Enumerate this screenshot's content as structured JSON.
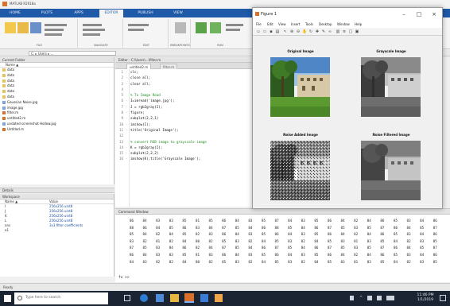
{
  "matlab": {
    "title": "MATLAB R2018a",
    "ribbon_tabs": [
      "HOME",
      "PLOTS",
      "APPS",
      "EDITOR",
      "PUBLISH",
      "VIEW"
    ],
    "active_tab": "EDITOR",
    "ribbon_groups": [
      "FILE",
      "NAVIGATE",
      "EDIT",
      "BREAKPOINTS",
      "RUN"
    ],
    "address_path": "C: ▸ Users ▸ ...",
    "current_folder": {
      "title": "Current Folder",
      "column": "Name ▲",
      "files": [
        "data",
        "data",
        "data",
        "data",
        "data",
        "data",
        "Gaussian Noise.jpg",
        "image.jpg",
        "filter.m",
        "untitled2.m",
        "undated screenshot Hollow.jpg",
        "Untitled.m"
      ],
      "details": "Details"
    },
    "workspace": {
      "title": "Workspace",
      "col_name": "Name ▲",
      "col_value": "Value",
      "rows": [
        {
          "name": "I",
          "value": "256x256 uint8"
        },
        {
          "name": "J",
          "value": "256x256 uint8"
        },
        {
          "name": "K",
          "value": "256x256 uint8"
        },
        {
          "name": "L",
          "value": "256x256 uint8"
        },
        {
          "name": "ans",
          "value": "3x3 filter coefficients"
        },
        {
          "name": "a1",
          "value": ""
        }
      ]
    },
    "editor": {
      "title": "Editor - C:\\Users\\...\\filter.m",
      "tabs": [
        "untitled2.m",
        "filter.m"
      ],
      "lines": [
        {
          "n": "1",
          "dash": "-",
          "code": "clc;",
          "kind": "code"
        },
        {
          "n": "2",
          "dash": "-",
          "code": "close all;",
          "kind": "code"
        },
        {
          "n": "3",
          "dash": "-",
          "code": "clear all;",
          "kind": "code"
        },
        {
          "n": "4",
          "dash": "",
          "code": "",
          "kind": "code"
        },
        {
          "n": "5",
          "dash": "",
          "code": "% To Image Read",
          "kind": "comment"
        },
        {
          "n": "6",
          "dash": "-",
          "code": "I=imread('image.jpg');",
          "kind": "code"
        },
        {
          "n": "7",
          "dash": "-",
          "code": "J = rgb2gray(I);",
          "kind": "code"
        },
        {
          "n": "8",
          "dash": "-",
          "code": "figure;",
          "kind": "code"
        },
        {
          "n": "9",
          "dash": "-",
          "code": "subplot(2,2,1)",
          "kind": "code"
        },
        {
          "n": "10",
          "dash": "-",
          "code": "imshow(I);",
          "kind": "code"
        },
        {
          "n": "11",
          "dash": "-",
          "code": "title('Original Image');",
          "kind": "code"
        },
        {
          "n": "12",
          "dash": "",
          "code": "",
          "kind": "code"
        },
        {
          "n": "13",
          "dash": "",
          "code": "% convert RGB image to grayscale image",
          "kind": "comment"
        },
        {
          "n": "14",
          "dash": "-",
          "code": "K = rgb2gray(I);",
          "kind": "code"
        },
        {
          "n": "15",
          "dash": "-",
          "code": "subplot(2,2,2)",
          "kind": "code"
        },
        {
          "n": "16",
          "dash": "-",
          "code": "imshow(K);title('Grayscale Image');",
          "kind": "code"
        }
      ]
    },
    "command_window": {
      "title": "Command Window",
      "rows": [
        [
          "86",
          "84",
          "83",
          "83",
          "85",
          "81",
          "85",
          "86",
          "84",
          "83",
          "85",
          "87",
          "84",
          "83",
          "85",
          "86",
          "84",
          "82",
          "84",
          "86",
          "85",
          "83",
          "84",
          "86"
        ],
        [
          "88",
          "86",
          "84",
          "85",
          "86",
          "83",
          "84",
          "87",
          "85",
          "84",
          "86",
          "88",
          "85",
          "84",
          "86",
          "87",
          "85",
          "83",
          "85",
          "87",
          "86",
          "84",
          "85",
          "87"
        ],
        [
          "85",
          "84",
          "82",
          "84",
          "85",
          "82",
          "83",
          "86",
          "84",
          "83",
          "85",
          "86",
          "84",
          "83",
          "85",
          "86",
          "84",
          "82",
          "84",
          "86",
          "85",
          "83",
          "84",
          "86"
        ],
        [
          "83",
          "82",
          "81",
          "82",
          "84",
          "80",
          "82",
          "85",
          "83",
          "82",
          "84",
          "85",
          "83",
          "82",
          "84",
          "85",
          "83",
          "81",
          "83",
          "85",
          "84",
          "82",
          "83",
          "85"
        ],
        [
          "87",
          "85",
          "83",
          "84",
          "86",
          "82",
          "84",
          "87",
          "85",
          "84",
          "86",
          "87",
          "85",
          "84",
          "86",
          "87",
          "85",
          "83",
          "85",
          "87",
          "86",
          "84",
          "85",
          "87"
        ],
        [
          "86",
          "84",
          "83",
          "83",
          "85",
          "81",
          "83",
          "86",
          "84",
          "83",
          "85",
          "86",
          "84",
          "83",
          "85",
          "86",
          "84",
          "82",
          "84",
          "86",
          "85",
          "83",
          "84",
          "86"
        ],
        [
          "84",
          "83",
          "82",
          "82",
          "84",
          "80",
          "82",
          "85",
          "83",
          "82",
          "84",
          "85",
          "83",
          "82",
          "84",
          "85",
          "83",
          "81",
          "83",
          "85",
          "84",
          "82",
          "83",
          "85"
        ]
      ],
      "prompt": "fx >>"
    },
    "status": "Ready"
  },
  "figure": {
    "title": "Figure 1",
    "menu": [
      "File",
      "Edit",
      "View",
      "Insert",
      "Tools",
      "Desktop",
      "Window",
      "Help"
    ],
    "tools": [
      "new-icon",
      "open-icon",
      "save-icon",
      "print-icon",
      "arrow-icon",
      "zoom-in-icon",
      "zoom-out-icon",
      "pan-icon",
      "rotate-icon",
      "datacursor-icon",
      "brush-icon",
      "link-icon",
      "colorbar-icon",
      "legend-icon",
      "hide-icon",
      "dock-icon"
    ],
    "plots": [
      {
        "title": "Original Image",
        "variant": "color"
      },
      {
        "title": "Grayscale Image",
        "variant": "gray"
      },
      {
        "title": "Noise Added Image",
        "variant": "noisy"
      },
      {
        "title": "Noise Filtered Image",
        "variant": "filtered"
      }
    ]
  },
  "taskbar": {
    "search_placeholder": "Type here to search",
    "time": "11:46 PM",
    "date": "1/1/2019"
  },
  "colors": {
    "ribbon_blue": "#1e5aa8",
    "taskbar": "#1b2433",
    "matlab_orange": "#d9702c"
  }
}
